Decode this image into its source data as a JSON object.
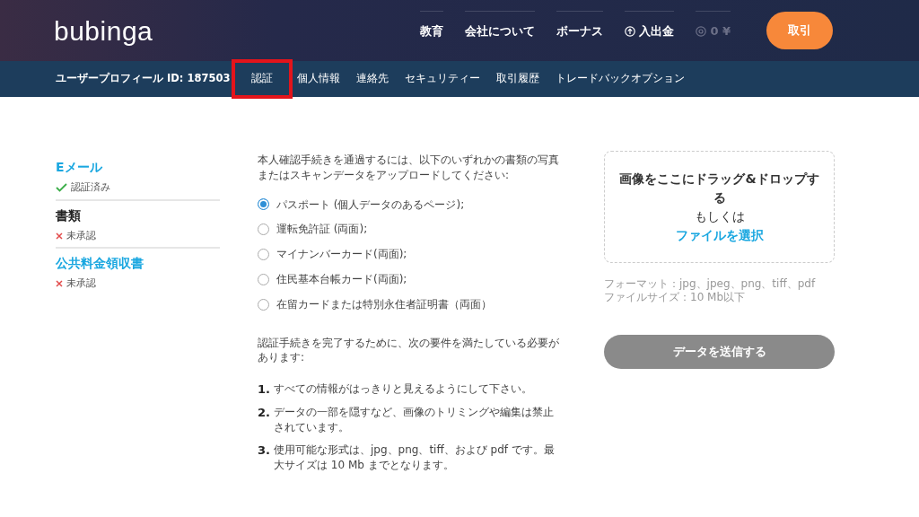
{
  "header": {
    "logo": "bubinga",
    "nav": [
      {
        "label": "教育"
      },
      {
        "label": "会社について"
      },
      {
        "label": "ボーナス"
      }
    ],
    "deposit": {
      "label": "入出金"
    },
    "balance": {
      "text": "0 ¥",
      "disabled": true
    },
    "trade_button": "取引"
  },
  "subnav": {
    "profile": "ユーザープロフィール ID: 187503",
    "tabs": [
      {
        "label": "認証",
        "highlighted": true
      },
      {
        "label": "個人情報",
        "highlighted": false
      },
      {
        "label": "連絡先",
        "highlighted": false
      },
      {
        "label": "セキュリティー",
        "highlighted": false
      },
      {
        "label": "取引履歴",
        "highlighted": false
      },
      {
        "label": "トレードバックオプション",
        "highlighted": false
      }
    ]
  },
  "sidebar": {
    "items": [
      {
        "title": "Eメール",
        "status": "認証済み",
        "kind": "verified",
        "selected": false
      },
      {
        "title": "書類",
        "status": "未承認",
        "kind": "rejected",
        "selected": true
      },
      {
        "title": "公共料金領収書",
        "status": "未承認",
        "kind": "rejected",
        "selected": false
      }
    ]
  },
  "instructions": "本人確認手続きを通過するには、以下のいずれかの書類の写真またはスキャンデータをアップロードしてください:",
  "documents": [
    {
      "label": "パスポート (個人データのあるページ);",
      "selected": true
    },
    {
      "label": "運転免許証 (両面);",
      "selected": false
    },
    {
      "label": "マイナンバーカード(両面);",
      "selected": false
    },
    {
      "label": "住民基本台帳カード(両面);",
      "selected": false
    },
    {
      "label": "在留カードまたは特別永住者証明書（両面）",
      "selected": false
    }
  ],
  "requirements_intro": "認証手続きを完了するために、次の要件を満たしている必要があります:",
  "requirements": [
    {
      "number": "1.",
      "text": "すべての情報がはっきりと見えるようにして下さい。"
    },
    {
      "number": "2.",
      "text": "データの一部を隠すなど、画像のトリミングや編集は禁止されています。"
    },
    {
      "number": "3.",
      "text": "使用可能な形式は、jpg、png、tiff、および pdf です。最大サイズは 10 Mb までとなります。"
    }
  ],
  "upload": {
    "drop_text": "画像をここにドラッグ&ドロップする",
    "or": "もしくは",
    "choose": "ファイルを選択",
    "formats": "フォーマット：jpg、jpeg、png、tiff、pdf",
    "size": "ファイルサイズ：10 Mb以下"
  },
  "submit": {
    "label": "データを送信する",
    "disabled": true
  }
}
